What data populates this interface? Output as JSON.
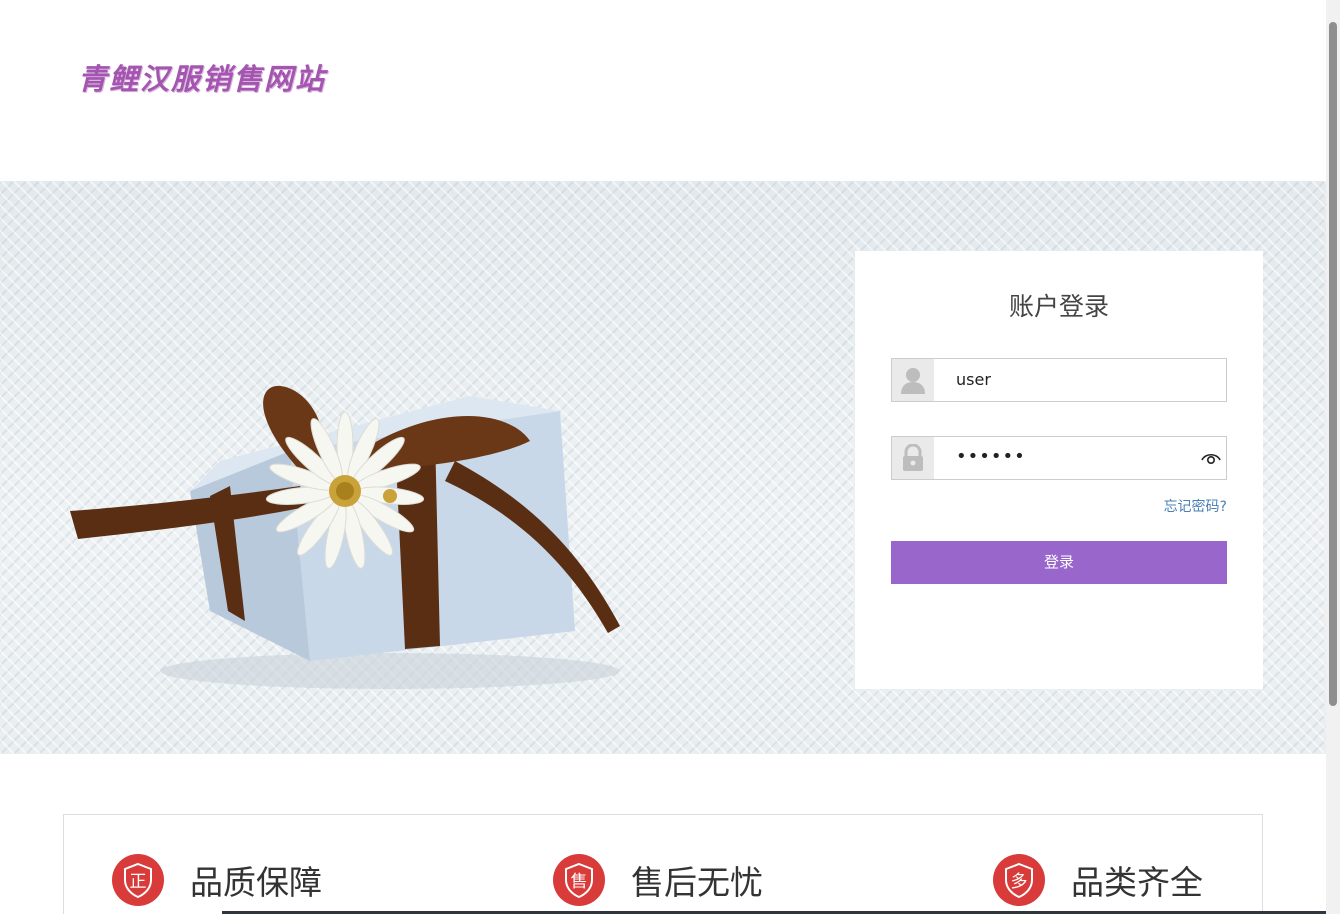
{
  "header": {
    "logo_text": "青鲤汉服销售网站"
  },
  "login": {
    "title": "账户登录",
    "username_value": "user",
    "password_value": "••••••",
    "forgot_label": "忘记密码?",
    "submit_label": "登录"
  },
  "features": [
    {
      "badge": "正",
      "label": "品质保障"
    },
    {
      "badge": "售",
      "label": "售后无忧"
    },
    {
      "badge": "多",
      "label": "品类齐全"
    }
  ],
  "colors": {
    "accent": "#9966cc",
    "badge_red": "#d93b3b",
    "link": "#4a7fb5",
    "logo": "#a455b0"
  },
  "icons": [
    "user-icon",
    "lock-icon",
    "eye-icon",
    "shield-badge-icon"
  ]
}
